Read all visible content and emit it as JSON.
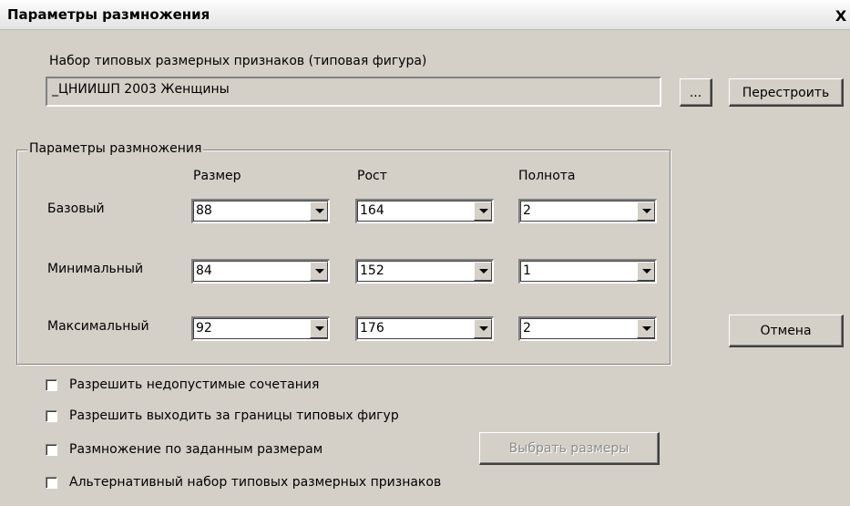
{
  "window": {
    "title": "Параметры размножения",
    "close_glyph": "X"
  },
  "figure_set": {
    "label": "Набор типовых размерных признаков (типовая фигура)",
    "value": "_ЦНИИШП 2003 Женщины",
    "browse_label": "...",
    "rebuild_label": "Перестроить"
  },
  "params_group": {
    "legend": "Параметры размножения",
    "columns": [
      "Размер",
      "Рост",
      "Полнота"
    ],
    "rows": [
      {
        "label": "Базовый",
        "values": [
          "88",
          "164",
          "2"
        ]
      },
      {
        "label": "Минимальный",
        "values": [
          "84",
          "152",
          "1"
        ]
      },
      {
        "label": "Максимальный",
        "values": [
          "92",
          "176",
          "2"
        ]
      }
    ]
  },
  "buttons": {
    "cancel_label": "Отмена",
    "choose_sizes_label": "Выбрать размеры"
  },
  "options": [
    {
      "label": "Разрешить недопустимые сочетания",
      "checked": false
    },
    {
      "label": "Разрешить выходить за границы типовых фигур",
      "checked": false
    },
    {
      "label": "Размножение по заданным размерам",
      "checked": false
    },
    {
      "label": "Альтернативный набор типовых размерных признаков",
      "checked": false
    }
  ]
}
